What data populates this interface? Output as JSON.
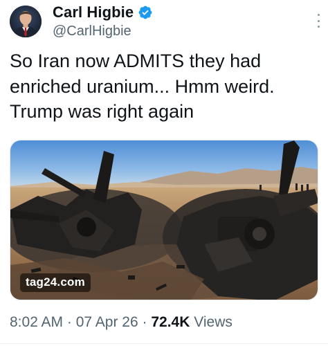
{
  "author": {
    "display_name": "Carl Higbie",
    "handle": "@CarlHigbie",
    "verified": true,
    "avatar_icon": "profile-photo"
  },
  "tweet": {
    "lines": [
      "So Iran now ADMITS they had",
      "enriched uranium... Hmm weird.",
      "Trump was right again"
    ]
  },
  "media": {
    "watermark": "tag24.com",
    "description_icon": "photo"
  },
  "meta": {
    "time": "8:02 AM",
    "separator": "·",
    "date": "07 Apr 26",
    "views_count": "72.4K",
    "views_label": "Views"
  },
  "colors": {
    "verified_blue": "#1d9bf0",
    "secondary_text": "#536471",
    "primary_text": "#0f1419"
  },
  "icons": {
    "verified": "verified-badge-icon",
    "more": "more-options-icon"
  }
}
